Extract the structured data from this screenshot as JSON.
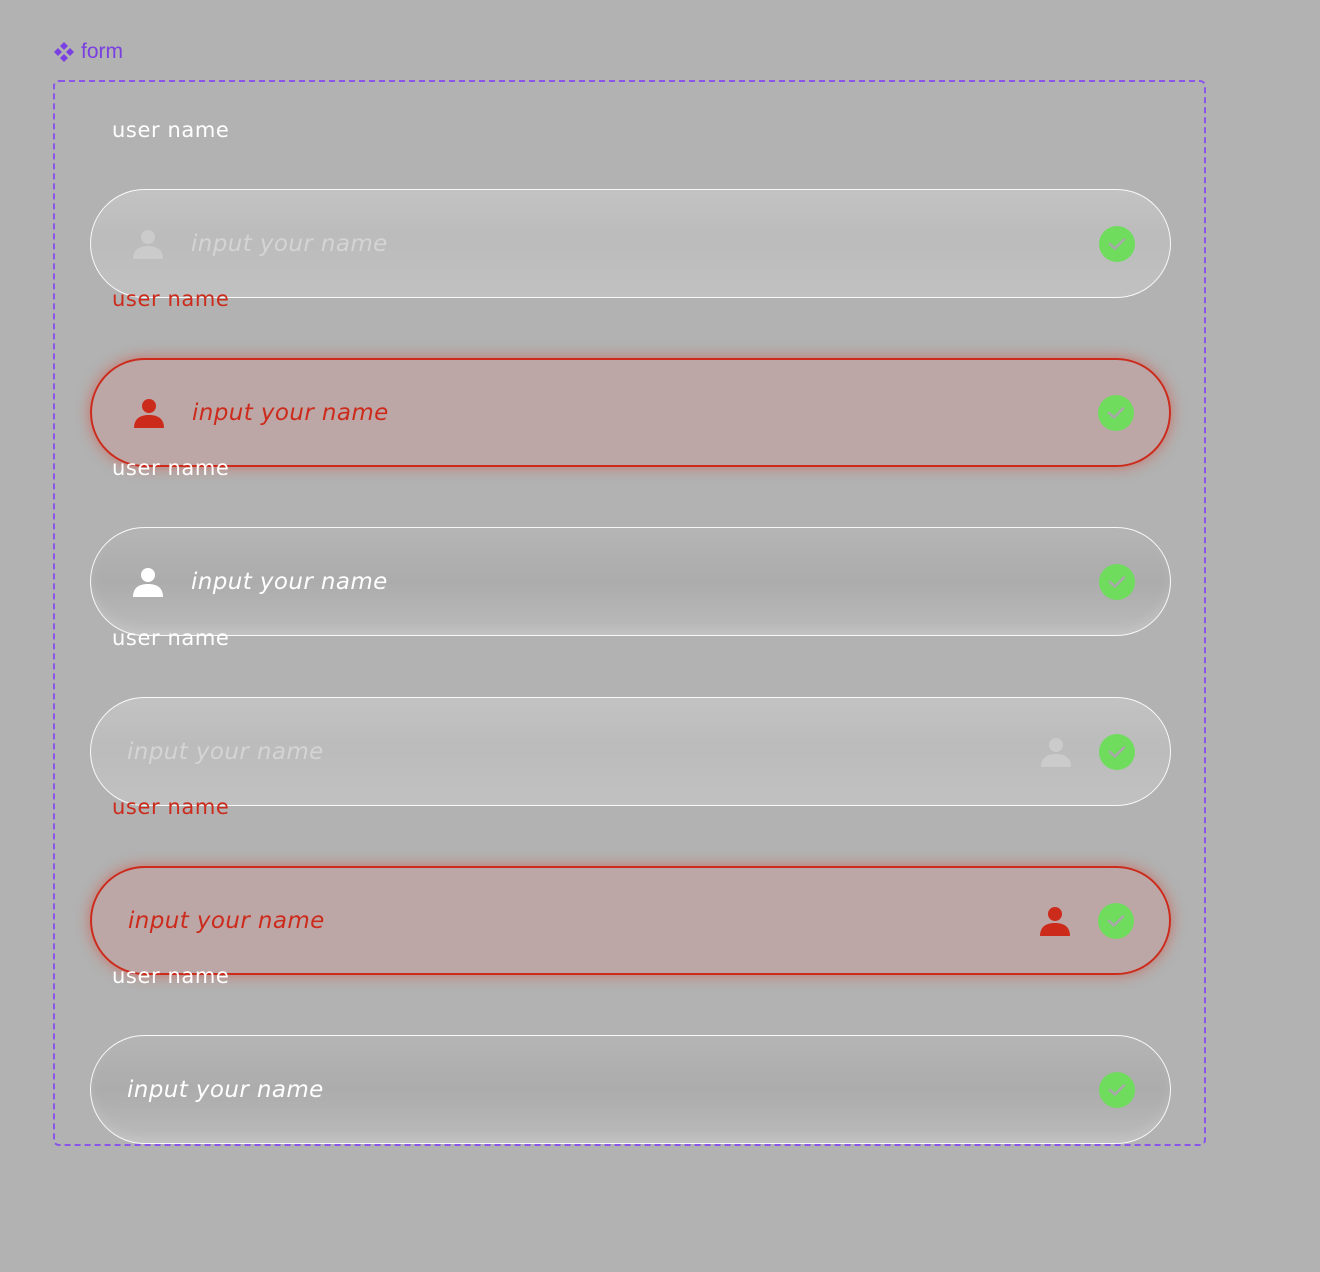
{
  "component": {
    "icon": "component-diamond-icon",
    "name": "form"
  },
  "colors": {
    "background": "#b2b2b2",
    "component_accent": "#7a3fe0",
    "error": "#cc2b1c",
    "success": "#6fdc5e",
    "label_normal": "#ffffff",
    "disabled_text": "#d4d4d4"
  },
  "fields": [
    {
      "label": "user name",
      "placeholder": "input your name",
      "state": "disabled",
      "icon_position": "leading",
      "icon": "user-icon",
      "status_icon": "check-icon"
    },
    {
      "label": "user name",
      "placeholder": "input your name",
      "state": "error",
      "icon_position": "leading",
      "icon": "user-icon",
      "status_icon": "check-icon"
    },
    {
      "label": "user name",
      "placeholder": "input your name",
      "state": "normal",
      "icon_position": "leading",
      "icon": "user-icon",
      "status_icon": "check-icon"
    },
    {
      "label": "user name",
      "placeholder": "input your name",
      "state": "disabled",
      "icon_position": "trailing",
      "icon": "user-icon",
      "status_icon": "check-icon"
    },
    {
      "label": "user name",
      "placeholder": "input your name",
      "state": "error",
      "icon_position": "trailing",
      "icon": "user-icon",
      "status_icon": "check-icon"
    },
    {
      "label": "user name",
      "placeholder": "input your name",
      "state": "normal",
      "icon_position": "none",
      "status_icon": "check-icon"
    }
  ]
}
